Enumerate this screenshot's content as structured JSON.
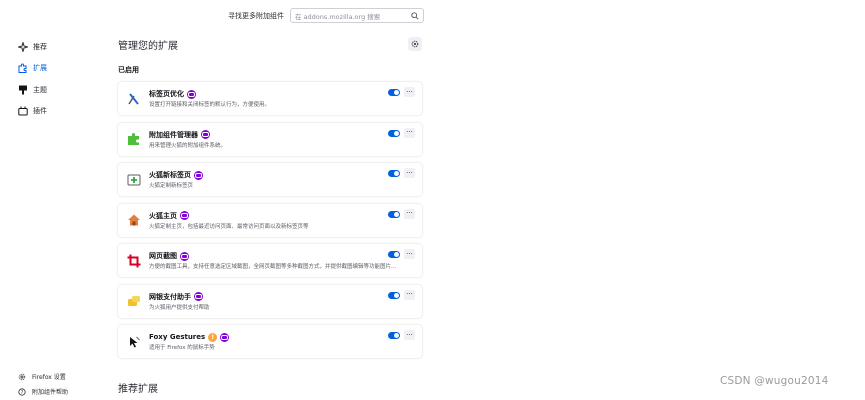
{
  "top": {
    "find_more_label": "寻找更多附加组件",
    "search_placeholder": "在 addons.mozilla.org 搜索"
  },
  "sidebar": {
    "items": [
      {
        "label": "推荐",
        "icon": "sparkle-icon"
      },
      {
        "label": "扩展",
        "icon": "puzzle-icon",
        "active": true
      },
      {
        "label": "主题",
        "icon": "brush-icon"
      },
      {
        "label": "插件",
        "icon": "plugin-icon"
      }
    ],
    "footer": [
      {
        "label": "Firefox 设置",
        "icon": "gear-icon"
      },
      {
        "label": "附加组件帮助",
        "icon": "help-icon"
      }
    ]
  },
  "main": {
    "title": "管理您的扩展",
    "enabled_heading": "已启用",
    "recommended_heading": "推荐扩展",
    "extensions": [
      {
        "name": "标签页优化",
        "desc": "设置打开链接和关闭标签的默认行为，方便使用。",
        "icon": "tab-tweak-icon",
        "enabled": true
      },
      {
        "name": "附加组件管理器",
        "desc": "用来管理火狐的附加组件系统。",
        "icon": "addon-manager-icon",
        "enabled": true
      },
      {
        "name": "火狐新标签页",
        "desc": "火狐定制新标签页",
        "icon": "new-tab-icon",
        "enabled": true
      },
      {
        "name": "火狐主页",
        "desc": "火狐定制主页，包括最近访问页面、最常访问页面以及新标签页等",
        "icon": "home-icon",
        "enabled": true
      },
      {
        "name": "网页截图",
        "desc": "方便的截图工具，支持任意选定区域截图，全网页截图等多种截图方式，并提供截图编辑等功能图片...",
        "icon": "crop-icon",
        "enabled": true
      },
      {
        "name": "网银支付助手",
        "desc": "为火狐用户提供支付帮助",
        "icon": "payment-icon",
        "enabled": true
      },
      {
        "name": "Foxy Gestures",
        "desc": "适用于 Firefox 的鼠标手势",
        "icon": "gesture-icon",
        "enabled": true,
        "extra_badge": "line-badge"
      }
    ]
  },
  "colors": {
    "accent": "#0061e0",
    "recommended_badge": "#8000d7",
    "line_badge": "#ffa436"
  },
  "watermark": "CSDN @wugou2014"
}
